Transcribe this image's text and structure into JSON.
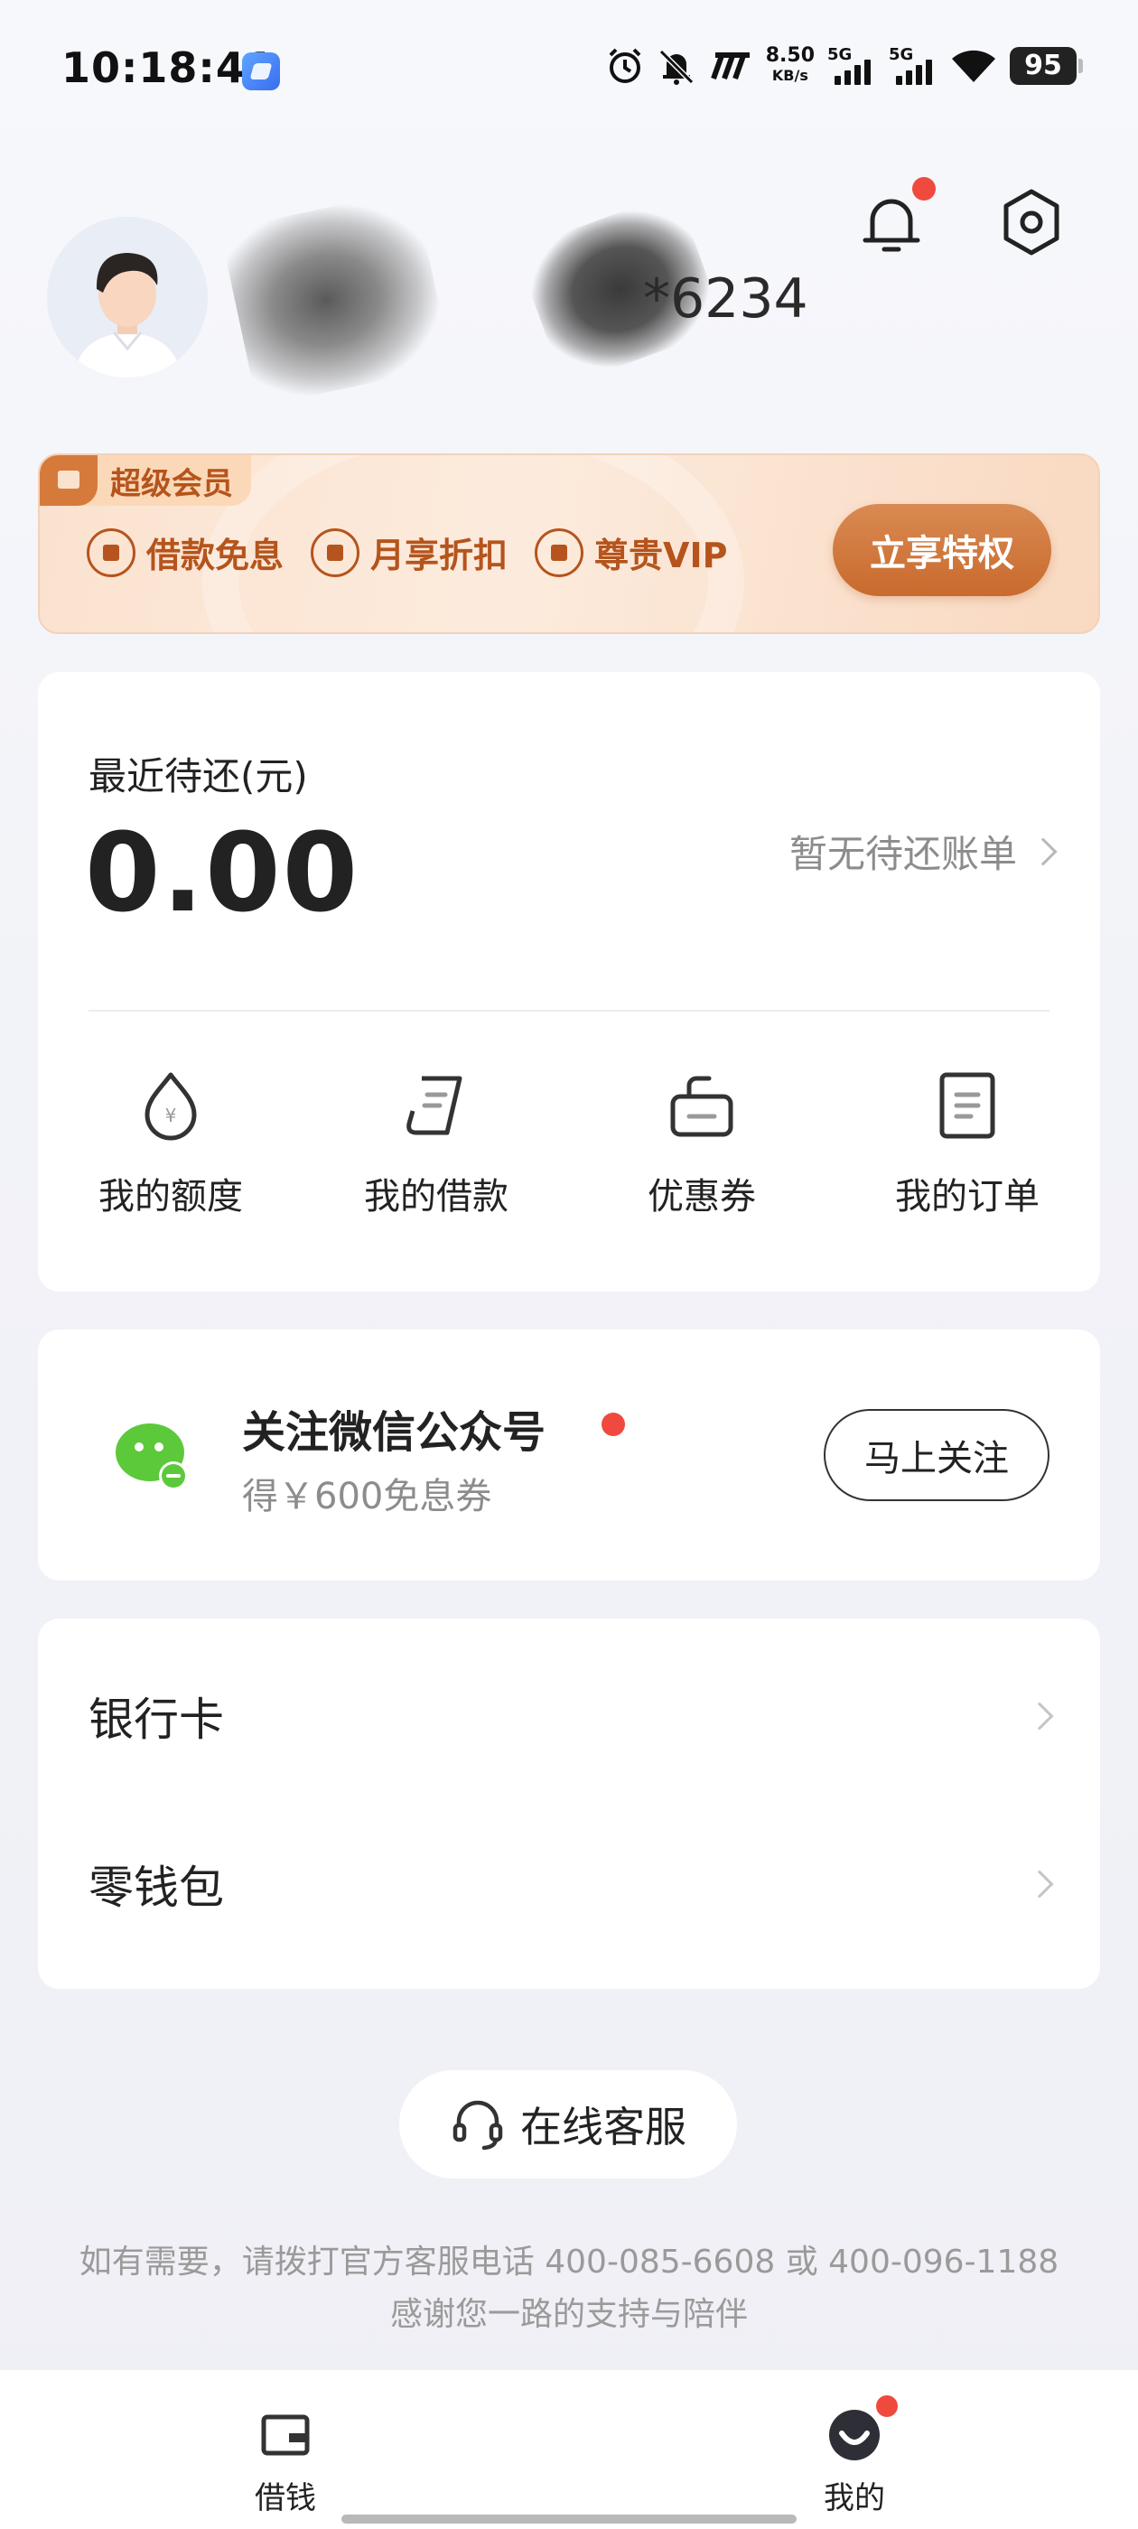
{
  "status_bar": {
    "time": "10:18:41",
    "speed_value": "8.50",
    "speed_unit": "KB/s",
    "signal_label_1": "5G",
    "signal_label_2": "5G",
    "battery": "95"
  },
  "profile": {
    "account_suffix": "*6234",
    "has_notification": true
  },
  "vip_banner": {
    "tag": "超级会员",
    "perks": [
      "借款免息",
      "月享折扣",
      "尊贵VIP"
    ],
    "button": "立享特权",
    "accent_color": "#b5541c"
  },
  "repayment": {
    "title": "最近待还(元)",
    "amount": "0.00",
    "link": "暂无待还账单",
    "shortcuts": [
      {
        "label": "我的额度",
        "icon": "credit-limit-icon"
      },
      {
        "label": "我的借款",
        "icon": "loan-document-icon"
      },
      {
        "label": "优惠券",
        "icon": "coupon-icon"
      },
      {
        "label": "我的订单",
        "icon": "order-icon"
      }
    ]
  },
  "wechat": {
    "title": "关注微信公众号",
    "subtitle": "得￥600免息券",
    "button": "马上关注"
  },
  "menu": {
    "items": [
      {
        "label": "银行卡"
      },
      {
        "label": "零钱包"
      }
    ]
  },
  "service": {
    "button": "在线客服",
    "hotline_line1": "如有需要，请拨打官方客服电话 400-085-6608 或 400-096-1188",
    "hotline_line2": "感谢您一路的支持与陪伴"
  },
  "tabbar": {
    "tabs": [
      {
        "label": "借钱",
        "icon": "wallet-icon"
      },
      {
        "label": "我的",
        "icon": "profile-smile-icon",
        "badge": true
      }
    ]
  },
  "colors": {
    "badge_red": "#f04a3e",
    "vip_button": "#c96a2e",
    "wechat_green": "#5cc93b"
  }
}
